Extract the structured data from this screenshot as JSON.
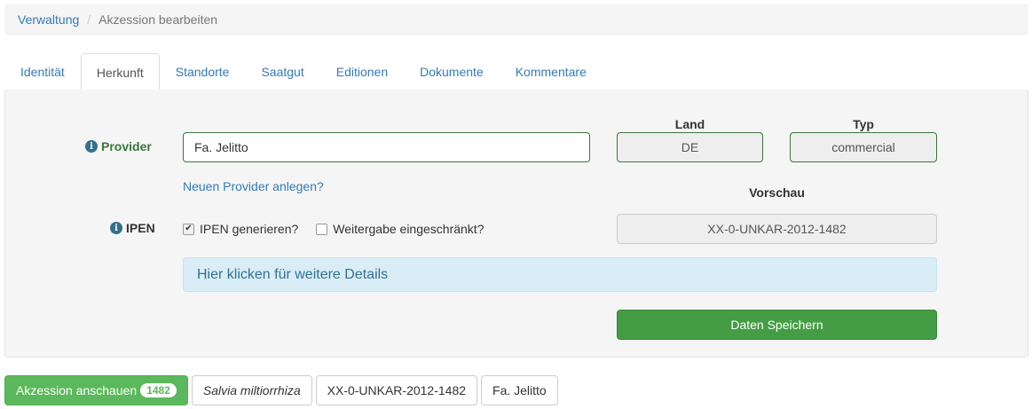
{
  "breadcrumb": {
    "root": "Verwaltung",
    "separator": "/",
    "current": "Akzession bearbeiten"
  },
  "tabs": [
    {
      "label": "Identität"
    },
    {
      "label": "Herkunft"
    },
    {
      "label": "Standorte"
    },
    {
      "label": "Saatgut"
    },
    {
      "label": "Editionen"
    },
    {
      "label": "Dokumente"
    },
    {
      "label": "Kommentare"
    }
  ],
  "form": {
    "provider_label": "Provider",
    "provider_value": "Fa. Jelitto",
    "new_provider_link": "Neuen Provider anlegen?",
    "land_header": "Land",
    "land_value": "DE",
    "typ_header": "Typ",
    "typ_value": "commercial",
    "vorschau_header": "Vorschau",
    "ipen_label": "IPEN",
    "ipen_generate_label": "IPEN generieren?",
    "ipen_generate_checked": true,
    "weitergabe_label": "Weitergabe eingeschränkt?",
    "weitergabe_checked": false,
    "preview_value": "XX-0-UNKAR-2012-1482",
    "details_alert": "Hier klicken für weitere Details",
    "save_button": "Daten Speichern",
    "info_icon_glyph": "i"
  },
  "bottom": {
    "view_button": "Akzession anschauen",
    "view_badge": "1482",
    "species": "Salvia miltiorrhiza",
    "accession_id": "XX-0-UNKAR-2012-1482",
    "provider": "Fa. Jelitto"
  },
  "colors": {
    "link": "#337ab7",
    "success": "#449d44",
    "success_light": "#5cb85c",
    "valid_border": "#3c763d",
    "info_bg": "#d9edf7",
    "info_text": "#31708f"
  }
}
